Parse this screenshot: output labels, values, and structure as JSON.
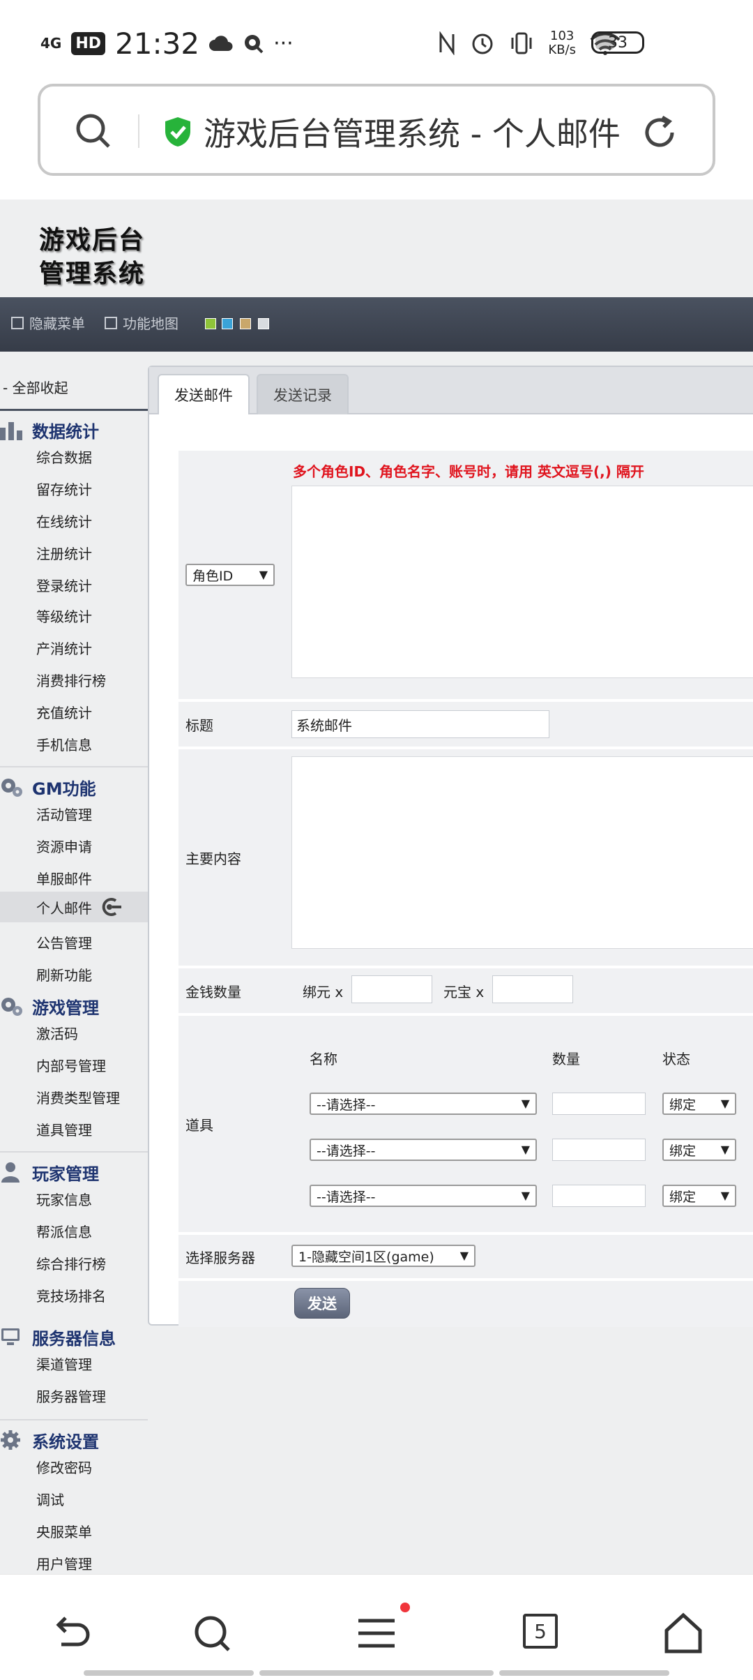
{
  "status_bar": {
    "network": "4G",
    "hd_badge": "HD",
    "time": "21:32",
    "more": "···",
    "speed_value": "103",
    "speed_unit": "KB/s",
    "battery": "33"
  },
  "url_bar": {
    "title": "游戏后台管理系统 - 个人邮件"
  },
  "site": {
    "logo_line1": "游戏后台",
    "logo_line2": "管理系统"
  },
  "topnav": {
    "hide_menu": "隐藏菜单",
    "function_map": "功能地图",
    "skin_colors": [
      "#8fc33a",
      "#3aa3d8",
      "#c9a76b",
      "#d9dce0"
    ]
  },
  "sidebar": {
    "collapse_all": "- 全部收起",
    "groups": [
      {
        "title": "数据统计",
        "icon": "bar-chart-icon",
        "items": [
          "综合数据",
          "留存统计",
          "在线统计",
          "注册统计",
          "登录统计",
          "等级统计",
          "产消统计",
          "消费排行榜",
          "充值统计",
          "手机信息"
        ]
      },
      {
        "title": "GM功能",
        "icon": "gears-icon",
        "items": [
          "活动管理",
          "资源申请",
          "单服邮件",
          "个人邮件",
          "公告管理",
          "刷新功能"
        ],
        "active": "个人邮件"
      },
      {
        "title": "游戏管理",
        "icon": "gears-icon",
        "items": [
          "激活码",
          "内部号管理",
          "消费类型管理",
          "道具管理"
        ]
      },
      {
        "title": "玩家管理",
        "icon": "user-icon",
        "items": [
          "玩家信息",
          "帮派信息",
          "综合排行榜",
          "竞技场排名"
        ]
      },
      {
        "title": "服务器信息",
        "icon": "server-icon",
        "items": [
          "渠道管理",
          "服务器管理"
        ]
      },
      {
        "title": "系统设置",
        "icon": "gear-icon",
        "items": [
          "修改密码",
          "调试",
          "央服菜单",
          "用户管理"
        ]
      }
    ]
  },
  "tabs": {
    "send_mail": "发送邮件",
    "send_log": "发送记录"
  },
  "form": {
    "target_select": "角色ID",
    "hint": "多个角色ID、角色名字、账号时，请用 英文逗号(,) 隔开",
    "title_label": "标题",
    "title_value": "系统邮件",
    "content_label": "主要内容",
    "money_label": "金钱数量",
    "bound_yuan": "绑元 x",
    "yuanbao": "元宝 x",
    "items_label": "道具",
    "col_name": "名称",
    "col_qty": "数量",
    "col_state": "状态",
    "item_rows": [
      {
        "name": "--请选择--",
        "state": "绑定"
      },
      {
        "name": "--请选择--",
        "state": "绑定"
      },
      {
        "name": "--请选择--",
        "state": "绑定"
      }
    ],
    "server_label": "选择服务器",
    "server_value": "1-隐藏空间1区(game)",
    "send_button": "发送"
  },
  "bottom_nav": {
    "tab_count": "5"
  }
}
